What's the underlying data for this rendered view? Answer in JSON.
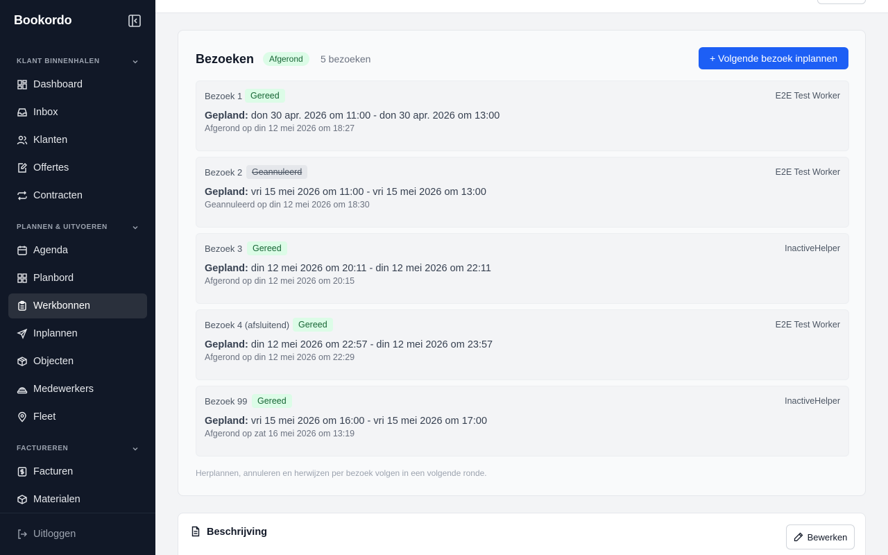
{
  "brand": "Bookordo",
  "sidebar": {
    "sections": [
      {
        "label": "KLANT BINNENHALEN",
        "items": [
          {
            "label": "Dashboard",
            "icon": "dashboard-icon"
          },
          {
            "label": "Inbox",
            "icon": "inbox-icon"
          },
          {
            "label": "Klanten",
            "icon": "users-icon"
          },
          {
            "label": "Offertes",
            "icon": "quote-icon"
          },
          {
            "label": "Contracten",
            "icon": "repeat-icon"
          }
        ]
      },
      {
        "label": "PLANNEN & UITVOEREN",
        "items": [
          {
            "label": "Agenda",
            "icon": "calendar-icon"
          },
          {
            "label": "Planbord",
            "icon": "board-icon"
          },
          {
            "label": "Werkbonnen",
            "icon": "clipboard-icon",
            "active": true
          },
          {
            "label": "Inplannen",
            "icon": "send-icon"
          },
          {
            "label": "Objecten",
            "icon": "box-icon"
          },
          {
            "label": "Medewerkers",
            "icon": "helmet-icon"
          },
          {
            "label": "Fleet",
            "icon": "map-pin-icon"
          }
        ]
      },
      {
        "label": "FACTUREREN",
        "items": [
          {
            "label": "Facturen",
            "icon": "invoice-icon"
          },
          {
            "label": "Materialen",
            "icon": "package-icon"
          }
        ]
      }
    ],
    "logout": "Uitloggen"
  },
  "visits_card": {
    "title": "Bezoeken",
    "status": "Afgerond",
    "count": "5 bezoeken",
    "primary_button": "+ Volgende bezoek inplannen",
    "planned_prefix": "Gepland:",
    "visits": [
      {
        "label": "Bezoek 1",
        "badge": "Gereed",
        "badge_type": "done",
        "worker": "E2E Test Worker",
        "planned": "don 30 apr. 2026 om 11:00 - don 30 apr. 2026 om 13:00",
        "sub": "Afgerond op din 12 mei 2026 om 18:27"
      },
      {
        "label": "Bezoek 2",
        "badge": "Geannuleerd",
        "badge_type": "cancel",
        "worker": "E2E Test Worker",
        "planned": "vri 15 mei 2026 om 11:00 - vri 15 mei 2026 om 13:00",
        "sub": "Geannuleerd op din 12 mei 2026 om 18:30"
      },
      {
        "label": "Bezoek 3",
        "badge": "Gereed",
        "badge_type": "done",
        "worker": "InactiveHelper",
        "planned": "din 12 mei 2026 om 20:11 - din 12 mei 2026 om 22:11",
        "sub": "Afgerond op din 12 mei 2026 om 20:15"
      },
      {
        "label": "Bezoek 4 (afsluitend)",
        "badge": "Gereed",
        "badge_type": "done",
        "worker": "E2E Test Worker",
        "planned": "din 12 mei 2026 om 22:57 - din 12 mei 2026 om 23:57",
        "sub": "Afgerond op din 12 mei 2026 om 22:29"
      },
      {
        "label": "Bezoek 99",
        "badge": "Gereed",
        "badge_type": "done",
        "worker": "InactiveHelper",
        "planned": "vri 15 mei 2026 om 16:00 - vri 15 mei 2026 om 17:00",
        "sub": "Afgerond op zat 16 mei 2026 om 13:19"
      }
    ],
    "footnote": "Herplannen, annuleren en herwijzen per bezoek volgen in een volgende ronde."
  },
  "description_card": {
    "title": "Beschrijving",
    "edit_button": "Bewerken"
  },
  "colors": {
    "sidebar_bg": "#111827",
    "primary": "#1d5ff5",
    "success_bg": "#dcfce7",
    "success_text": "#166534"
  }
}
